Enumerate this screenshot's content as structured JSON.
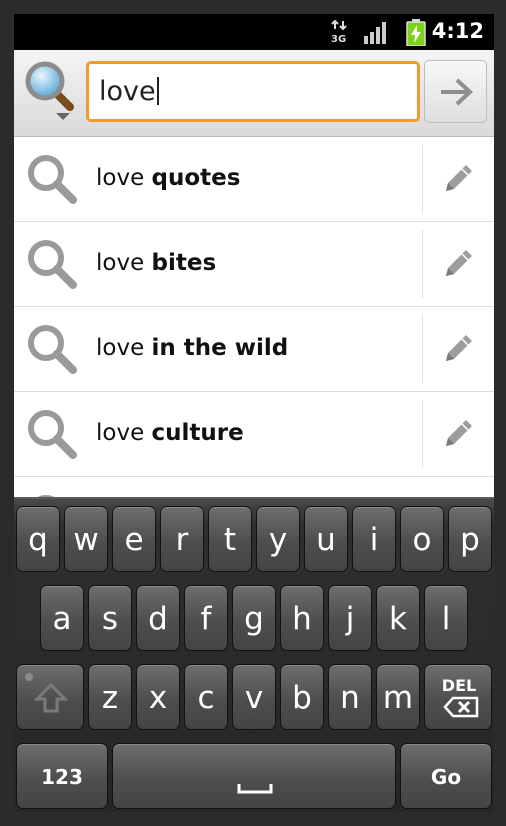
{
  "status_bar": {
    "network": "3G",
    "time": "4:12"
  },
  "search": {
    "engine_icon": "search-icon",
    "query": "love",
    "go_icon": "arrow-right-icon"
  },
  "suggestions": [
    {
      "prefix": "love",
      "completion": "quotes"
    },
    {
      "prefix": "love",
      "completion": "bites"
    },
    {
      "prefix": "love",
      "completion": "in the wild"
    },
    {
      "prefix": "love",
      "completion": "culture"
    }
  ],
  "keyboard": {
    "row1": [
      "q",
      "w",
      "e",
      "r",
      "t",
      "y",
      "u",
      "i",
      "o",
      "p"
    ],
    "row2": [
      "a",
      "s",
      "d",
      "f",
      "g",
      "h",
      "j",
      "k",
      "l"
    ],
    "row3": [
      "z",
      "x",
      "c",
      "v",
      "b",
      "n",
      "m"
    ],
    "shift_icon": "shift-icon",
    "del_label": "DEL",
    "symbols_label": "123",
    "space_icon": "space-icon",
    "go_label": "Go"
  },
  "colors": {
    "focus_border": "#f39a2b",
    "battery": "#7ad418"
  }
}
